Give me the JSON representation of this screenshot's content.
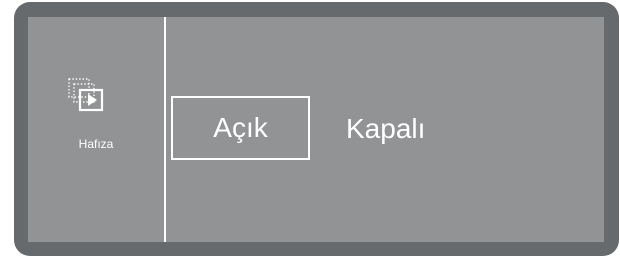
{
  "sidebar": {
    "memory": {
      "label": "Hafıza",
      "icon": "memory-icon"
    }
  },
  "options": {
    "on": {
      "label": "Açık",
      "selected": true
    },
    "off": {
      "label": "Kapalı",
      "selected": false
    }
  },
  "colors": {
    "bezel": "#676a6c",
    "screen": "#929395",
    "foreground": "#ffffff"
  }
}
